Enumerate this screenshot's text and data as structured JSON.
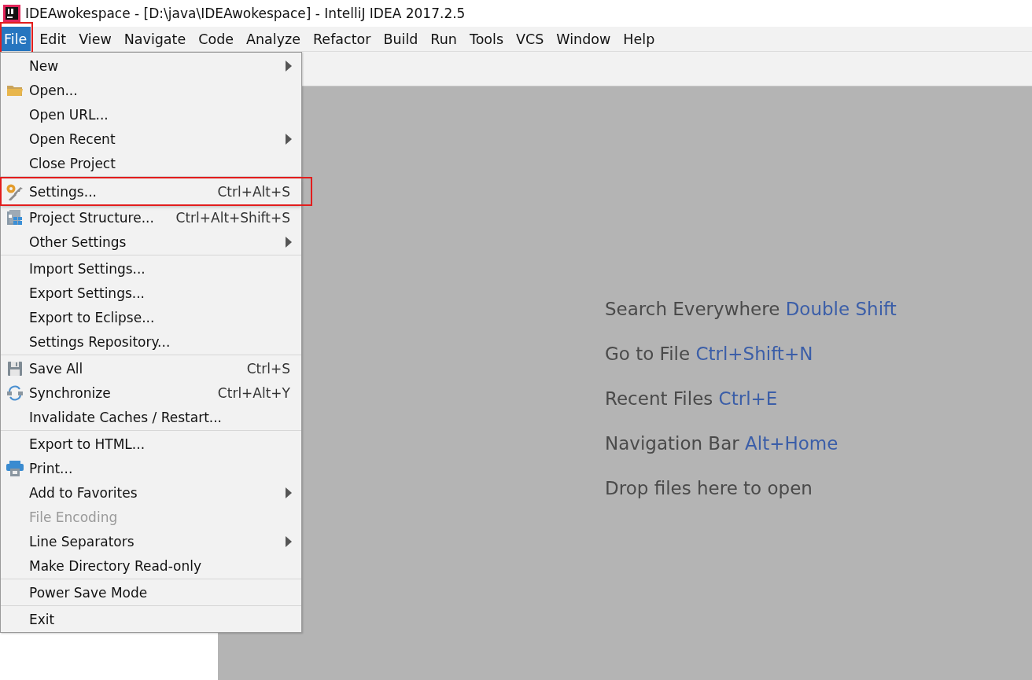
{
  "window": {
    "title": "IDEAwokespace - [D:\\java\\IDEAwokespace] - IntelliJ IDEA 2017.2.5"
  },
  "menu_bar": [
    {
      "label": "File",
      "selected": true,
      "annotated": true
    },
    {
      "label": "Edit",
      "selected": false,
      "annotated": false
    },
    {
      "label": "View",
      "selected": false,
      "annotated": false
    },
    {
      "label": "Navigate",
      "selected": false,
      "annotated": false
    },
    {
      "label": "Code",
      "selected": false,
      "annotated": false
    },
    {
      "label": "Analyze",
      "selected": false,
      "annotated": false
    },
    {
      "label": "Refactor",
      "selected": false,
      "annotated": false
    },
    {
      "label": "Build",
      "selected": false,
      "annotated": false
    },
    {
      "label": "Run",
      "selected": false,
      "annotated": false
    },
    {
      "label": "Tools",
      "selected": false,
      "annotated": false
    },
    {
      "label": "VCS",
      "selected": false,
      "annotated": false
    },
    {
      "label": "Window",
      "selected": false,
      "annotated": false
    },
    {
      "label": "Help",
      "selected": false,
      "annotated": false
    }
  ],
  "file_menu": {
    "sections": [
      [
        {
          "label": "New",
          "submenu": true,
          "disabled": false,
          "annotated": false
        },
        {
          "label": "Open...",
          "submenu": false,
          "disabled": false,
          "annotated": false
        },
        {
          "label": "Open URL...",
          "submenu": false,
          "disabled": false,
          "annotated": false
        },
        {
          "label": "Open Recent",
          "submenu": true,
          "disabled": false,
          "annotated": false
        },
        {
          "label": "Close Project",
          "submenu": false,
          "disabled": false,
          "annotated": false
        }
      ],
      [
        {
          "label": "Settings...",
          "shortcut": "Ctrl+Alt+S",
          "submenu": false,
          "disabled": false,
          "annotated": true
        },
        {
          "label": "Project Structure...",
          "shortcut": "Ctrl+Alt+Shift+S",
          "submenu": false,
          "disabled": false,
          "annotated": false
        },
        {
          "label": "Other Settings",
          "submenu": true,
          "disabled": false,
          "annotated": false
        }
      ],
      [
        {
          "label": "Import Settings...",
          "submenu": false,
          "disabled": false,
          "annotated": false
        },
        {
          "label": "Export Settings...",
          "submenu": false,
          "disabled": false,
          "annotated": false
        },
        {
          "label": "Export to Eclipse...",
          "submenu": false,
          "disabled": false,
          "annotated": false
        },
        {
          "label": "Settings Repository...",
          "submenu": false,
          "disabled": false,
          "annotated": false
        }
      ],
      [
        {
          "label": "Save All",
          "shortcut": "Ctrl+S",
          "submenu": false,
          "disabled": false,
          "annotated": false
        },
        {
          "label": "Synchronize",
          "shortcut": "Ctrl+Alt+Y",
          "submenu": false,
          "disabled": false,
          "annotated": false
        },
        {
          "label": "Invalidate Caches / Restart...",
          "submenu": false,
          "disabled": false,
          "annotated": false
        }
      ],
      [
        {
          "label": "Export to HTML...",
          "submenu": false,
          "disabled": false,
          "annotated": false
        },
        {
          "label": "Print...",
          "submenu": false,
          "disabled": false,
          "annotated": false
        },
        {
          "label": "Add to Favorites",
          "submenu": true,
          "disabled": false,
          "annotated": false
        },
        {
          "label": "File Encoding",
          "submenu": false,
          "disabled": true,
          "annotated": false
        },
        {
          "label": "Line Separators",
          "submenu": true,
          "disabled": false,
          "annotated": false
        },
        {
          "label": "Make Directory Read-only",
          "submenu": false,
          "disabled": false,
          "annotated": false
        }
      ],
      [
        {
          "label": "Power Save Mode",
          "submenu": false,
          "disabled": false,
          "annotated": false
        }
      ],
      [
        {
          "label": "Exit",
          "submenu": false,
          "disabled": false,
          "annotated": false
        }
      ]
    ]
  },
  "editor_hints": [
    {
      "text": "Search Everywhere",
      "shortcut": "Double Shift"
    },
    {
      "text": "Go to File",
      "shortcut": "Ctrl+Shift+N"
    },
    {
      "text": "Recent Files",
      "shortcut": "Ctrl+E"
    },
    {
      "text": "Navigation Bar",
      "shortcut": "Alt+Home"
    },
    {
      "text": "Drop files here to open"
    }
  ]
}
